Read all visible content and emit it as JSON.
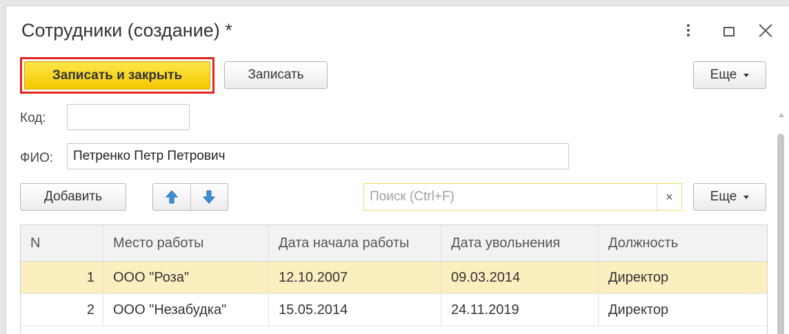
{
  "window": {
    "title": "Сотрудники (создание) *"
  },
  "toolbar": {
    "save_close_label": "Записать и закрыть",
    "save_label": "Записать",
    "more_label": "Еще"
  },
  "form": {
    "code_label": "Код:",
    "code_value": "",
    "fio_label": "ФИО:",
    "fio_value": "Петренко Петр Петрович"
  },
  "table_toolbar": {
    "add_label": "Добавить",
    "search_placeholder": "Поиск (Ctrl+F)",
    "clear_label": "×",
    "more_label": "Еще"
  },
  "table": {
    "columns": [
      "N",
      "Место работы",
      "Дата начала работы",
      "Дата увольнения",
      "Должность"
    ],
    "rows": [
      {
        "n": "1",
        "place": "ООО \"Роза\"",
        "start": "12.10.2007",
        "end": "09.03.2014",
        "position": "Директор"
      },
      {
        "n": "2",
        "place": "ООО \"Незабудка\"",
        "start": "15.05.2014",
        "end": "24.11.2019",
        "position": "Директор"
      }
    ]
  },
  "colors": {
    "primary_button": "#f5c800",
    "highlight_border": "#e2231a",
    "selected_row": "#fbeebf",
    "arrow_icon": "#3b8fd9"
  },
  "icons": {
    "menu": "more-vertical-icon",
    "maximize": "maximize-icon",
    "close": "close-icon",
    "move_up": "arrow-up-icon",
    "move_down": "arrow-down-icon"
  }
}
